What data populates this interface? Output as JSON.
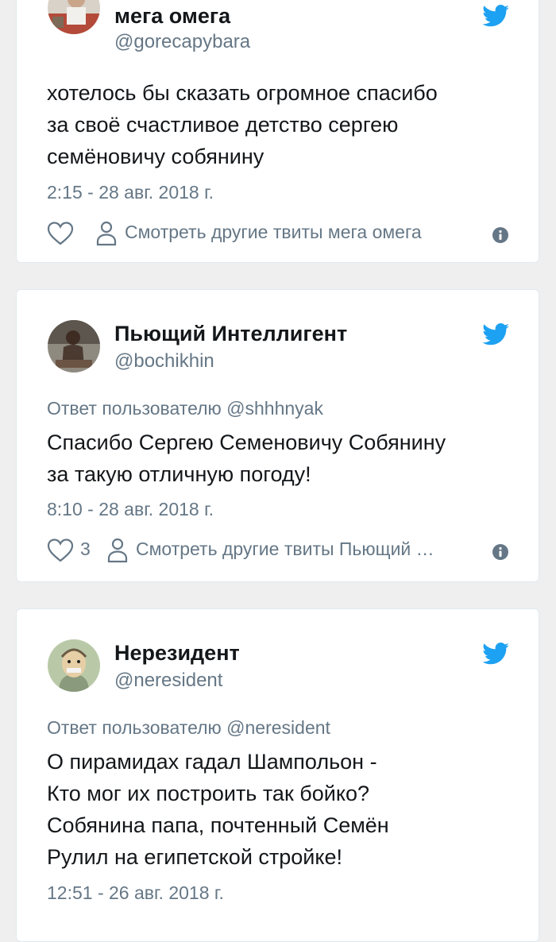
{
  "tweets": [
    {
      "name": "мега омега",
      "handle": "@gorecapybara",
      "reply_to": "",
      "text": "хотелось бы сказать огромное спасибо\nза своё счастливое детство сергею\nсемёновичу собянину",
      "time": "2:15 - 28 авг. 2018 г.",
      "likes": "",
      "more_link": "Смотреть другие твиты мега омега"
    },
    {
      "name": "Пьющий Интеллигент",
      "handle": "@bochikhin",
      "reply_to": "Ответ пользователю @shhhnyak",
      "text": "Спасибо Сергею Семеновичу Собянину\nза такую отличную погоду!",
      "time": "8:10 - 28 авг. 2018 г.",
      "likes": "3",
      "more_link": "Смотреть другие твиты Пьющий …"
    },
    {
      "name": "Нерезидент",
      "handle": "@neresident",
      "reply_to": "Ответ пользователю @neresident",
      "text": "О пирамидах гадал Шампольон -\nКто мог их построить так бойко?\nСобянина папа, почтенный Семён\nРулил на египетской стройке!",
      "time": "12:51 - 26 авг. 2018 г.",
      "likes": "",
      "more_link": ""
    }
  ],
  "colors": {
    "twitter_blue": "#1da1f2",
    "secondary_text": "#657786",
    "page_background": "#efefef"
  },
  "icons": [
    "twitter-bird-icon",
    "heart-icon",
    "person-icon",
    "info-icon"
  ]
}
